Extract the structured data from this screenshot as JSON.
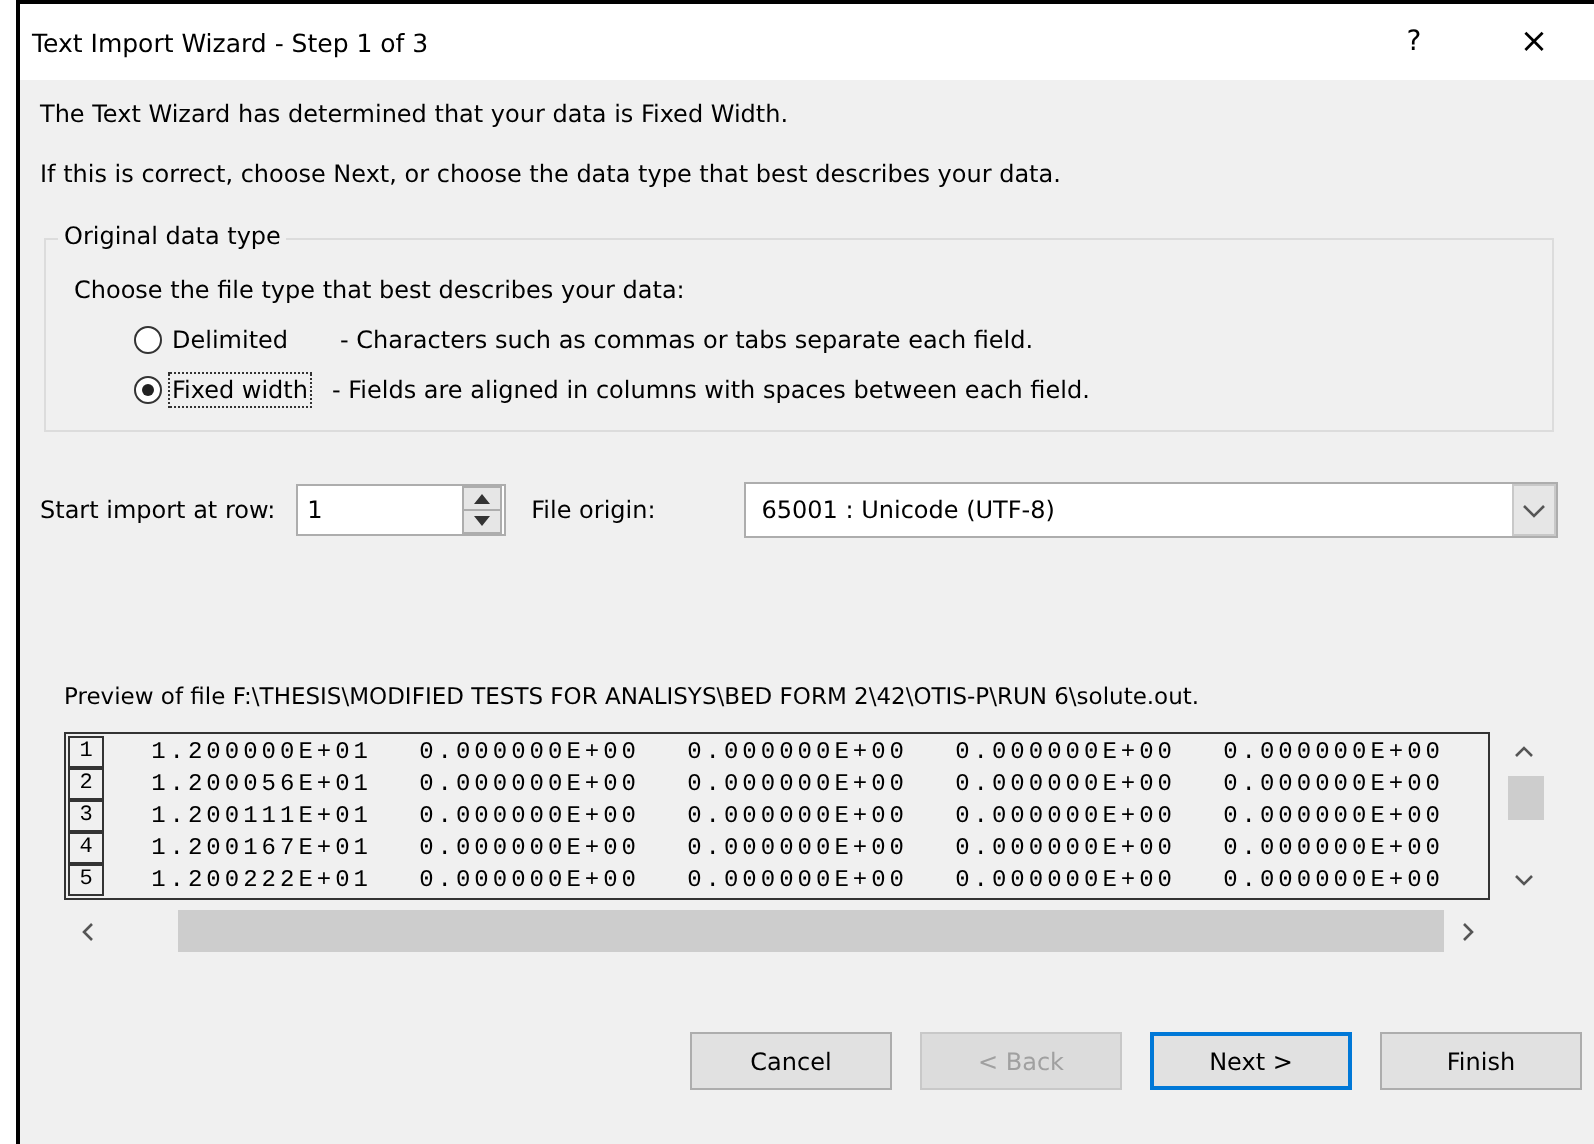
{
  "window": {
    "title": "Text Import Wizard - Step 1 of 3",
    "help": "?",
    "close": "×"
  },
  "intro": [
    "The Text Wizard has determined that your data is Fixed Width.",
    "If this is correct, choose Next, or choose the data type that best describes your data."
  ],
  "group": {
    "legend": "Original data type",
    "prompt": "Choose the file type that best describes your data:",
    "options": [
      {
        "label": "Delimited",
        "description": "- Characters such as commas or tabs separate each field.",
        "selected": false
      },
      {
        "label": "Fixed width",
        "description": "- Fields are aligned in columns with spaces between each field.",
        "selected": true
      }
    ]
  },
  "start_row": {
    "label": "Start import at row:",
    "value": "1"
  },
  "file_origin": {
    "label": "File origin:",
    "value": "65001 : Unicode (UTF-8)"
  },
  "preview": {
    "caption": "Preview of file F:\\THESIS\\MODIFIED TESTS FOR ANALISYS\\BED FORM 2\\42\\OTIS-P\\RUN 6\\solute.out.",
    "rows": [
      {
        "number": "1",
        "cells": [
          "1.200000E+01",
          "0.000000E+00",
          "0.000000E+00",
          "0.000000E+00",
          "0.000000E+00"
        ]
      },
      {
        "number": "2",
        "cells": [
          "1.200056E+01",
          "0.000000E+00",
          "0.000000E+00",
          "0.000000E+00",
          "0.000000E+00"
        ]
      },
      {
        "number": "3",
        "cells": [
          "1.200111E+01",
          "0.000000E+00",
          "0.000000E+00",
          "0.000000E+00",
          "0.000000E+00"
        ]
      },
      {
        "number": "4",
        "cells": [
          "1.200167E+01",
          "0.000000E+00",
          "0.000000E+00",
          "0.000000E+00",
          "0.000000E+00"
        ]
      },
      {
        "number": "5",
        "cells": [
          "1.200222E+01",
          "0.000000E+00",
          "0.000000E+00",
          "0.000000E+00",
          "0.000000E+00"
        ]
      }
    ]
  },
  "buttons": [
    {
      "label": "Cancel",
      "disabled": false,
      "default": false
    },
    {
      "label": "< Back",
      "disabled": true,
      "default": false
    },
    {
      "label": "Next >",
      "disabled": false,
      "default": true
    },
    {
      "label": "Finish",
      "disabled": false,
      "default": false
    }
  ]
}
